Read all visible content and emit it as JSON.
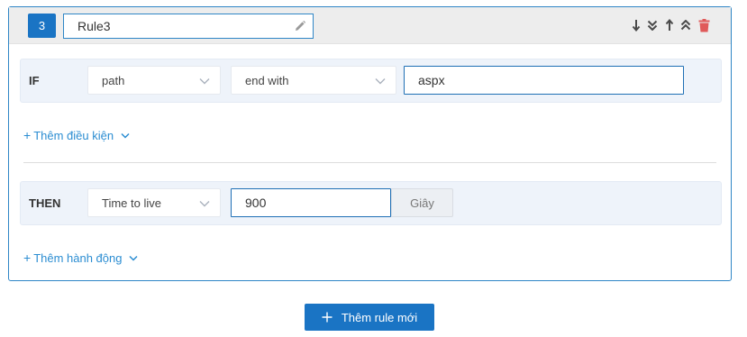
{
  "rule": {
    "number": "3",
    "name": "Rule3",
    "toolbar": {
      "icons": [
        "move-down-icon",
        "move-bottom-icon",
        "move-up-icon",
        "move-top-icon",
        "delete-icon"
      ],
      "delete_color": "#e05a5a",
      "icon_color": "#4a4a4a"
    }
  },
  "condition": {
    "label": "IF",
    "field": "path",
    "operator": "end with",
    "value": "aspx",
    "add_label": "Thêm điều kiện"
  },
  "action": {
    "label": "THEN",
    "type": "Time to live",
    "value": "900",
    "unit": "Giây",
    "add_label": "Thêm hành động"
  },
  "new_rule_button": "Thêm rule mới",
  "colors": {
    "primary": "#1a74c4",
    "link": "#2b8dd2",
    "row_bg": "#eef3fa",
    "header_bg": "#ededed"
  }
}
